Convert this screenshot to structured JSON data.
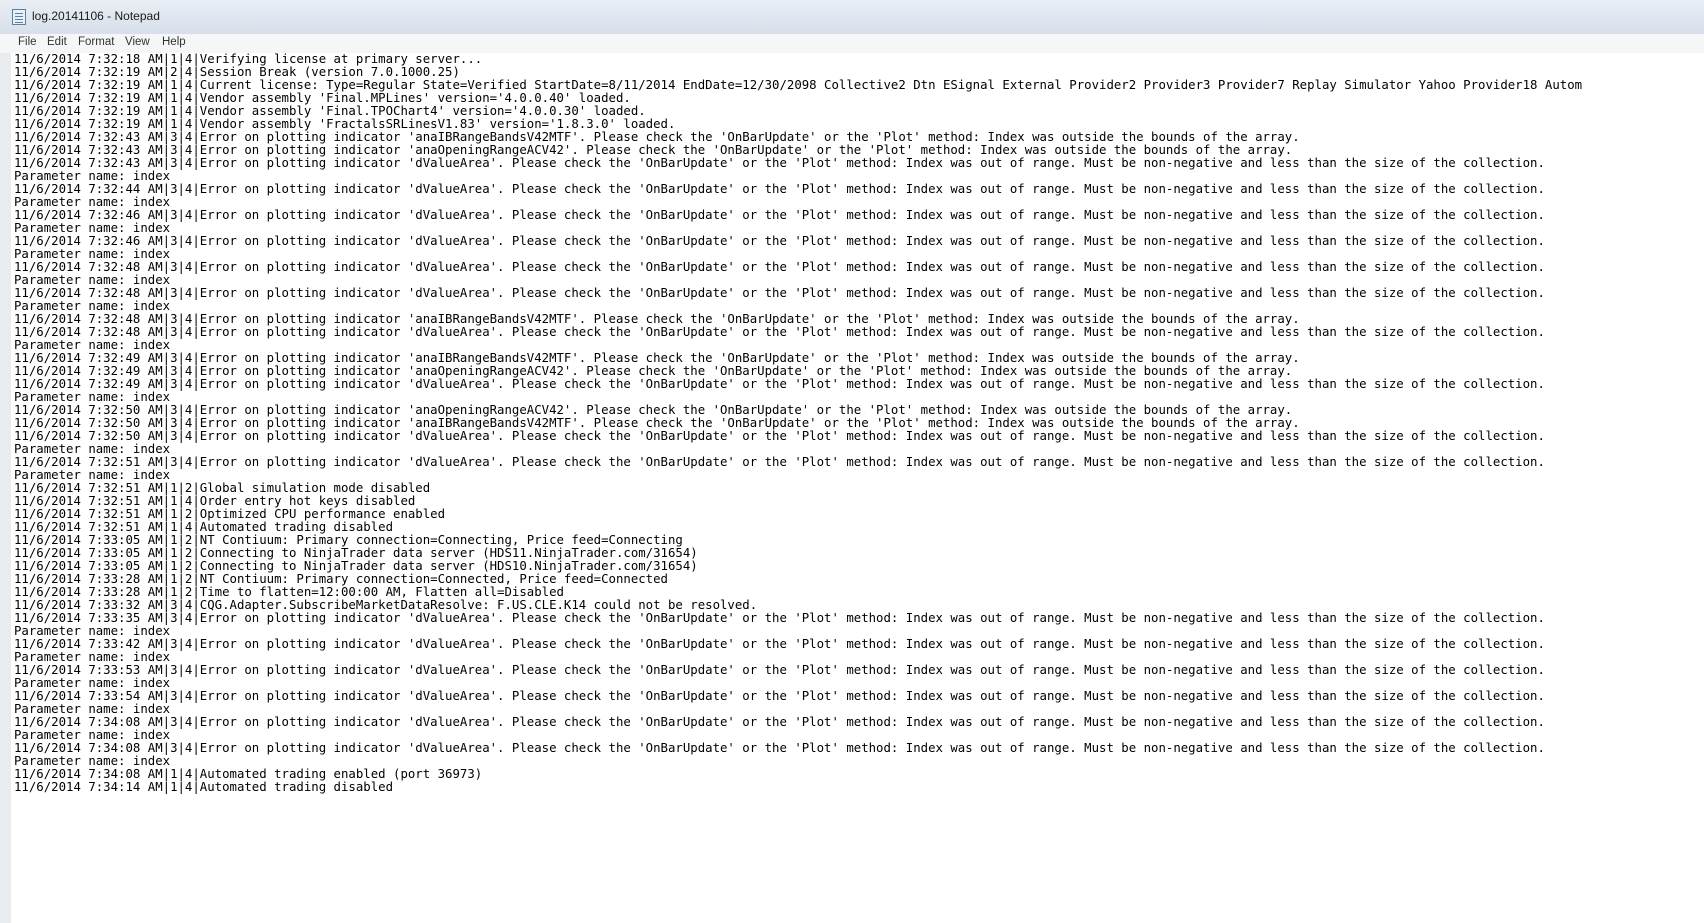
{
  "window": {
    "title": "log.20141106 - Notepad"
  },
  "menu": {
    "items": [
      "File",
      "Edit",
      "Format",
      "View",
      "Help"
    ]
  },
  "icons": {
    "app": "notepad-icon"
  },
  "document": {
    "lines": [
      "11/6/2014 7:32:18 AM|1|4|Verifying license at primary server...",
      "11/6/2014 7:32:19 AM|2|4|Session Break (version 7.0.1000.25)",
      "11/6/2014 7:32:19 AM|1|4|Current license: Type=Regular State=Verified StartDate=8/11/2014 EndDate=12/30/2098 Collective2 Dtn ESignal External Provider2 Provider3 Provider7 Replay Simulator Yahoo Provider18 Autom",
      "11/6/2014 7:32:19 AM|1|4|Vendor assembly 'Final.MPLines' version='4.0.0.40' loaded.",
      "11/6/2014 7:32:19 AM|1|4|Vendor assembly 'Final.TPOChart4' version='4.0.0.30' loaded.",
      "11/6/2014 7:32:19 AM|1|4|Vendor assembly 'FractalsSRLinesV1.83' version='1.8.3.0' loaded.",
      "11/6/2014 7:32:43 AM|3|4|Error on plotting indicator 'anaIBRangeBandsV42MTF'. Please check the 'OnBarUpdate' or the 'Plot' method: Index was outside the bounds of the array.",
      "11/6/2014 7:32:43 AM|3|4|Error on plotting indicator 'anaOpeningRangeACV42'. Please check the 'OnBarUpdate' or the 'Plot' method: Index was outside the bounds of the array.",
      "11/6/2014 7:32:43 AM|3|4|Error on plotting indicator 'dValueArea'. Please check the 'OnBarUpdate' or the 'Plot' method: Index was out of range. Must be non-negative and less than the size of the collection.",
      "Parameter name: index",
      "11/6/2014 7:32:44 AM|3|4|Error on plotting indicator 'dValueArea'. Please check the 'OnBarUpdate' or the 'Plot' method: Index was out of range. Must be non-negative and less than the size of the collection.",
      "Parameter name: index",
      "11/6/2014 7:32:46 AM|3|4|Error on plotting indicator 'dValueArea'. Please check the 'OnBarUpdate' or the 'Plot' method: Index was out of range. Must be non-negative and less than the size of the collection.",
      "Parameter name: index",
      "11/6/2014 7:32:46 AM|3|4|Error on plotting indicator 'dValueArea'. Please check the 'OnBarUpdate' or the 'Plot' method: Index was out of range. Must be non-negative and less than the size of the collection.",
      "Parameter name: index",
      "11/6/2014 7:32:48 AM|3|4|Error on plotting indicator 'dValueArea'. Please check the 'OnBarUpdate' or the 'Plot' method: Index was out of range. Must be non-negative and less than the size of the collection.",
      "Parameter name: index",
      "11/6/2014 7:32:48 AM|3|4|Error on plotting indicator 'dValueArea'. Please check the 'OnBarUpdate' or the 'Plot' method: Index was out of range. Must be non-negative and less than the size of the collection.",
      "Parameter name: index",
      "11/6/2014 7:32:48 AM|3|4|Error on plotting indicator 'anaIBRangeBandsV42MTF'. Please check the 'OnBarUpdate' or the 'Plot' method: Index was outside the bounds of the array.",
      "11/6/2014 7:32:48 AM|3|4|Error on plotting indicator 'dValueArea'. Please check the 'OnBarUpdate' or the 'Plot' method: Index was out of range. Must be non-negative and less than the size of the collection.",
      "Parameter name: index",
      "11/6/2014 7:32:49 AM|3|4|Error on plotting indicator 'anaIBRangeBandsV42MTF'. Please check the 'OnBarUpdate' or the 'Plot' method: Index was outside the bounds of the array.",
      "11/6/2014 7:32:49 AM|3|4|Error on plotting indicator 'anaOpeningRangeACV42'. Please check the 'OnBarUpdate' or the 'Plot' method: Index was outside the bounds of the array.",
      "11/6/2014 7:32:49 AM|3|4|Error on plotting indicator 'dValueArea'. Please check the 'OnBarUpdate' or the 'Plot' method: Index was out of range. Must be non-negative and less than the size of the collection.",
      "Parameter name: index",
      "11/6/2014 7:32:50 AM|3|4|Error on plotting indicator 'anaOpeningRangeACV42'. Please check the 'OnBarUpdate' or the 'Plot' method: Index was outside the bounds of the array.",
      "11/6/2014 7:32:50 AM|3|4|Error on plotting indicator 'anaIBRangeBandsV42MTF'. Please check the 'OnBarUpdate' or the 'Plot' method: Index was outside the bounds of the array.",
      "11/6/2014 7:32:50 AM|3|4|Error on plotting indicator 'dValueArea'. Please check the 'OnBarUpdate' or the 'Plot' method: Index was out of range. Must be non-negative and less than the size of the collection.",
      "Parameter name: index",
      "11/6/2014 7:32:51 AM|3|4|Error on plotting indicator 'dValueArea'. Please check the 'OnBarUpdate' or the 'Plot' method: Index was out of range. Must be non-negative and less than the size of the collection.",
      "Parameter name: index",
      "11/6/2014 7:32:51 AM|1|2|Global simulation mode disabled",
      "11/6/2014 7:32:51 AM|1|4|Order entry hot keys disabled",
      "11/6/2014 7:32:51 AM|1|2|Optimized CPU performance enabled",
      "11/6/2014 7:32:51 AM|1|4|Automated trading disabled",
      "11/6/2014 7:33:05 AM|1|2|NT Contiuum: Primary connection=Connecting, Price feed=Connecting",
      "11/6/2014 7:33:05 AM|1|2|Connecting to NinjaTrader data server (HDS11.NinjaTrader.com/31654)",
      "11/6/2014 7:33:05 AM|1|2|Connecting to NinjaTrader data server (HDS10.NinjaTrader.com/31654)",
      "11/6/2014 7:33:28 AM|1|2|NT Contiuum: Primary connection=Connected, Price feed=Connected",
      "11/6/2014 7:33:28 AM|1|2|Time to flatten=12:00:00 AM, Flatten all=Disabled",
      "11/6/2014 7:33:32 AM|3|4|CQG.Adapter.SubscribeMarketDataResolve: F.US.CLE.K14 could not be resolved.",
      "11/6/2014 7:33:35 AM|3|4|Error on plotting indicator 'dValueArea'. Please check the 'OnBarUpdate' or the 'Plot' method: Index was out of range. Must be non-negative and less than the size of the collection.",
      "Parameter name: index",
      "11/6/2014 7:33:42 AM|3|4|Error on plotting indicator 'dValueArea'. Please check the 'OnBarUpdate' or the 'Plot' method: Index was out of range. Must be non-negative and less than the size of the collection.",
      "Parameter name: index",
      "11/6/2014 7:33:53 AM|3|4|Error on plotting indicator 'dValueArea'. Please check the 'OnBarUpdate' or the 'Plot' method: Index was out of range. Must be non-negative and less than the size of the collection.",
      "Parameter name: index",
      "11/6/2014 7:33:54 AM|3|4|Error on plotting indicator 'dValueArea'. Please check the 'OnBarUpdate' or the 'Plot' method: Index was out of range. Must be non-negative and less than the size of the collection.",
      "Parameter name: index",
      "11/6/2014 7:34:08 AM|3|4|Error on plotting indicator 'dValueArea'. Please check the 'OnBarUpdate' or the 'Plot' method: Index was out of range. Must be non-negative and less than the size of the collection.",
      "Parameter name: index",
      "11/6/2014 7:34:08 AM|3|4|Error on plotting indicator 'dValueArea'. Please check the 'OnBarUpdate' or the 'Plot' method: Index was out of range. Must be non-negative and less than the size of the collection.",
      "Parameter name: index",
      "11/6/2014 7:34:08 AM|1|4|Automated trading enabled (port 36973)",
      "11/6/2014 7:34:14 AM|1|4|Automated trading disabled"
    ]
  }
}
